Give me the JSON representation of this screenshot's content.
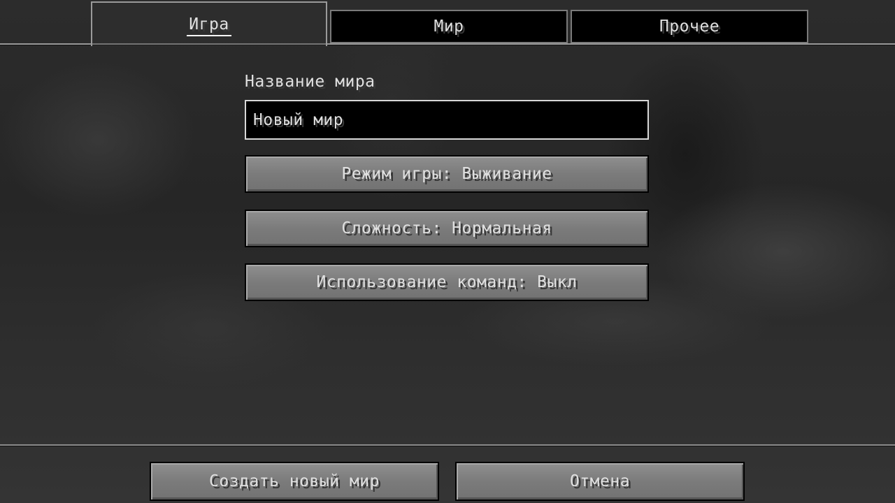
{
  "tabs": {
    "game": "Игра",
    "world": "Мир",
    "other": "Прочее"
  },
  "world_name": {
    "label": "Название мира",
    "value": "Новый мир"
  },
  "options": {
    "game_mode": "Режим игры: Выживание",
    "difficulty": "Сложность: Нормальная",
    "commands": "Использование команд: Выкл"
  },
  "footer": {
    "create": "Создать новый мир",
    "cancel": "Отмена"
  }
}
